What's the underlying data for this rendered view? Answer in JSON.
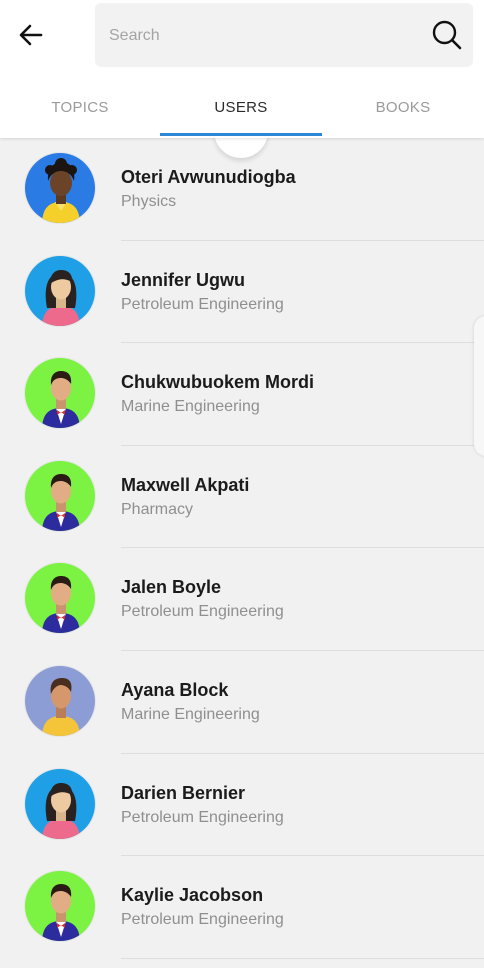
{
  "header": {
    "back_icon": "arrow-left-icon",
    "search": {
      "placeholder": "Search",
      "value": "",
      "icon": "search-icon"
    }
  },
  "tabs": [
    {
      "label": "TOPICS",
      "active": false
    },
    {
      "label": "USERS",
      "active": true
    },
    {
      "label": "BOOKS",
      "active": false
    }
  ],
  "colors": {
    "accent": "#2b86d6",
    "avatar_green": "#7cf242",
    "avatar_blue": "#1e9fe6",
    "avatar_purple": "#8c9dd6",
    "avatar_deep_blue": "#2a7be4"
  },
  "users": [
    {
      "name": "Oteri Avwunudiogba",
      "department": "Physics",
      "avatar": "avatar-woman-curly-hair-icon",
      "avatar_bg": "#2a7be4"
    },
    {
      "name": "Jennifer Ugwu",
      "department": "Petroleum Engineering",
      "avatar": "avatar-woman-icon",
      "avatar_bg": "#1e9fe6"
    },
    {
      "name": "Chukwubuokem Mordi",
      "department": "Marine Engineering",
      "avatar": "avatar-man-suit-icon",
      "avatar_bg": "#7cf242"
    },
    {
      "name": "Maxwell Akpati",
      "department": "Pharmacy",
      "avatar": "avatar-man-suit-icon",
      "avatar_bg": "#7cf242"
    },
    {
      "name": "Jalen Boyle",
      "department": "Petroleum Engineering",
      "avatar": "avatar-man-suit-icon",
      "avatar_bg": "#7cf242"
    },
    {
      "name": "Ayana Block",
      "department": "Marine Engineering",
      "avatar": "avatar-man-yellow-shirt-icon",
      "avatar_bg": "#8c9dd6"
    },
    {
      "name": "Darien Bernier",
      "department": "Petroleum Engineering",
      "avatar": "avatar-woman-icon",
      "avatar_bg": "#1e9fe6"
    },
    {
      "name": "Kaylie Jacobson",
      "department": "Petroleum Engineering",
      "avatar": "avatar-man-suit-icon",
      "avatar_bg": "#7cf242"
    }
  ]
}
